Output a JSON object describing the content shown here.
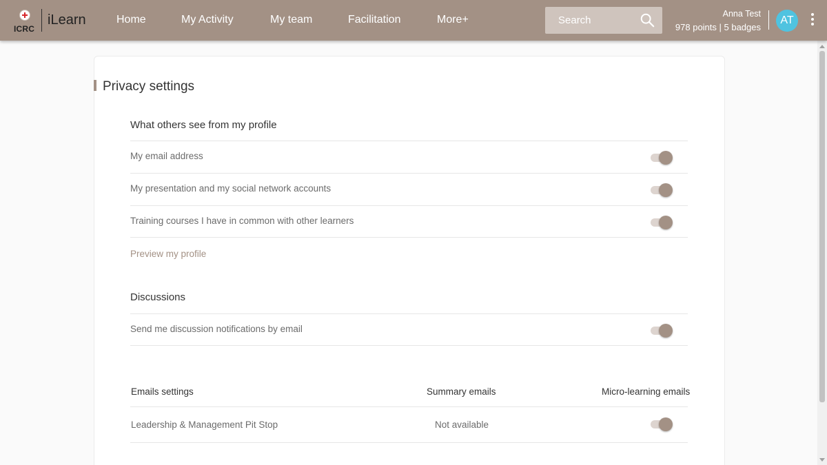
{
  "header": {
    "org_logo_text": "ICRC",
    "app_name": "iLearn",
    "nav": [
      "Home",
      "My Activity",
      "My team",
      "Facilitation",
      "More+"
    ],
    "search_placeholder": "Search",
    "user_name": "Anna Test",
    "user_stats": "978 points | 5 badges",
    "avatar_initials": "AT",
    "brand_color": "#a39185",
    "avatar_color": "#4fc3e0"
  },
  "page": {
    "title": "Privacy settings"
  },
  "profile_section": {
    "heading": "What others see from my profile",
    "items": [
      {
        "label": "My email address",
        "enabled": true
      },
      {
        "label": "My presentation and my social network accounts",
        "enabled": true
      },
      {
        "label": "Training courses I have in common with other learners",
        "enabled": true
      }
    ],
    "preview_link": "Preview my profile"
  },
  "discussions_section": {
    "heading": "Discussions",
    "items": [
      {
        "label": "Send me discussion notifications by email",
        "enabled": true
      }
    ]
  },
  "emails_section": {
    "columns": [
      "Emails settings",
      "Summary emails",
      "Micro-learning emails"
    ],
    "rows": [
      {
        "name": "Leadership & Management Pit Stop",
        "summary": "Not available",
        "micro_learning_enabled": true
      }
    ]
  }
}
